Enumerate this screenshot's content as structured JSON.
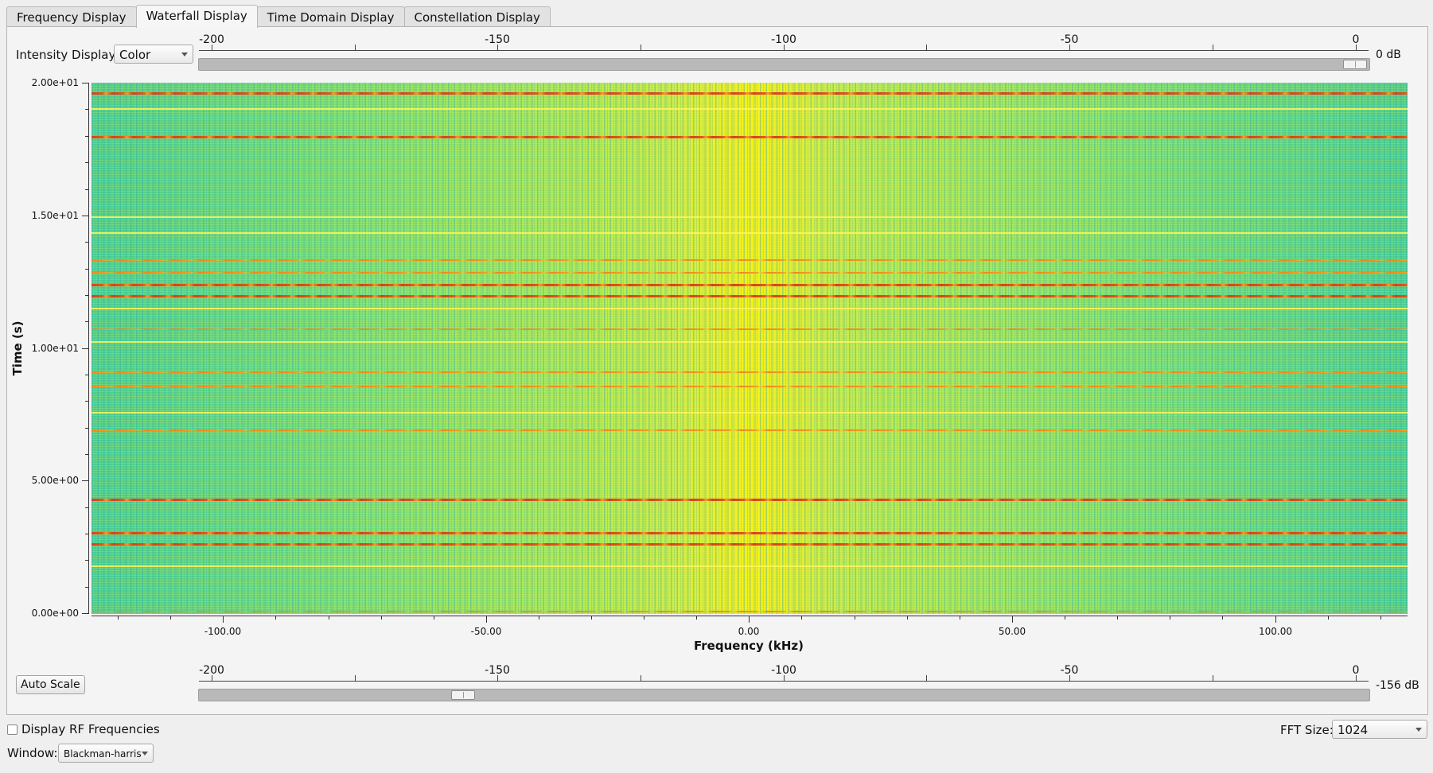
{
  "tabs": [
    "Frequency Display",
    "Waterfall Display",
    "Time Domain Display",
    "Constellation Display"
  ],
  "active_tab": 1,
  "intensity": {
    "label": "Intensity Display:",
    "value": "Color"
  },
  "scale_labels": [
    "-200",
    "-150",
    "-100",
    "-50",
    "0"
  ],
  "top_slider": {
    "db_label": "0 dB",
    "value_db": 0
  },
  "bottom_slider": {
    "db_label": "-156 dB",
    "value_db": -156
  },
  "y_axis": {
    "title": "Time (s)",
    "labels": [
      "2.00e+01",
      "1.50e+01",
      "1.00e+01",
      "5.00e+00",
      "0.00e+00"
    ]
  },
  "x_axis": {
    "title": "Frequency (kHz)",
    "labels": [
      "-100.00",
      "-50.00",
      "0.00",
      "50.00",
      "100.00"
    ]
  },
  "auto_scale_label": "Auto Scale",
  "rf_checkbox": {
    "label": "Display RF Frequencies",
    "checked": false
  },
  "fft": {
    "label": "FFT Size:",
    "value": "1024"
  },
  "window": {
    "label": "Window:",
    "value": "Blackman-harris"
  },
  "colors": {
    "low": "#4fd08e",
    "mid": "#b8ea4e",
    "high": "#e4ef38",
    "peak": "#d8401e"
  }
}
